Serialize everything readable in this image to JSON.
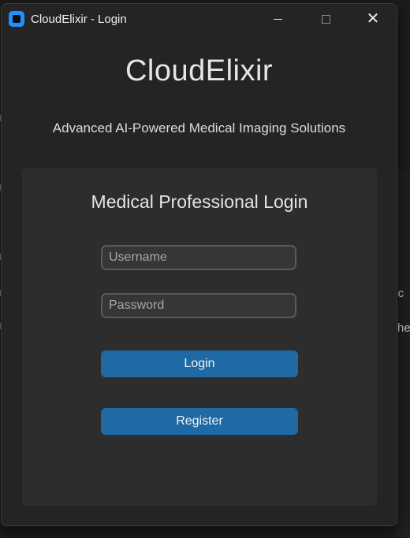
{
  "window": {
    "title": "CloudElixir - Login"
  },
  "header": {
    "brand": "CloudElixir",
    "tagline": "Advanced AI-Powered Medical Imaging Solutions"
  },
  "login_card": {
    "title": "Medical Professional Login",
    "username_placeholder": "Username",
    "username_value": "",
    "password_placeholder": "Password",
    "password_value": "",
    "login_label": "Login",
    "register_label": "Register"
  },
  "background": {
    "fragment_1": "s c",
    "fragment_2": "her"
  },
  "colors": {
    "window_bg": "#242424",
    "card_bg": "#2d2d2d",
    "button": "#1f6aa5",
    "app_icon": "#1e90ff"
  },
  "icons": {
    "app": "app-icon",
    "minimize": "minimize-icon",
    "maximize": "maximize-icon",
    "close": "close-icon"
  }
}
